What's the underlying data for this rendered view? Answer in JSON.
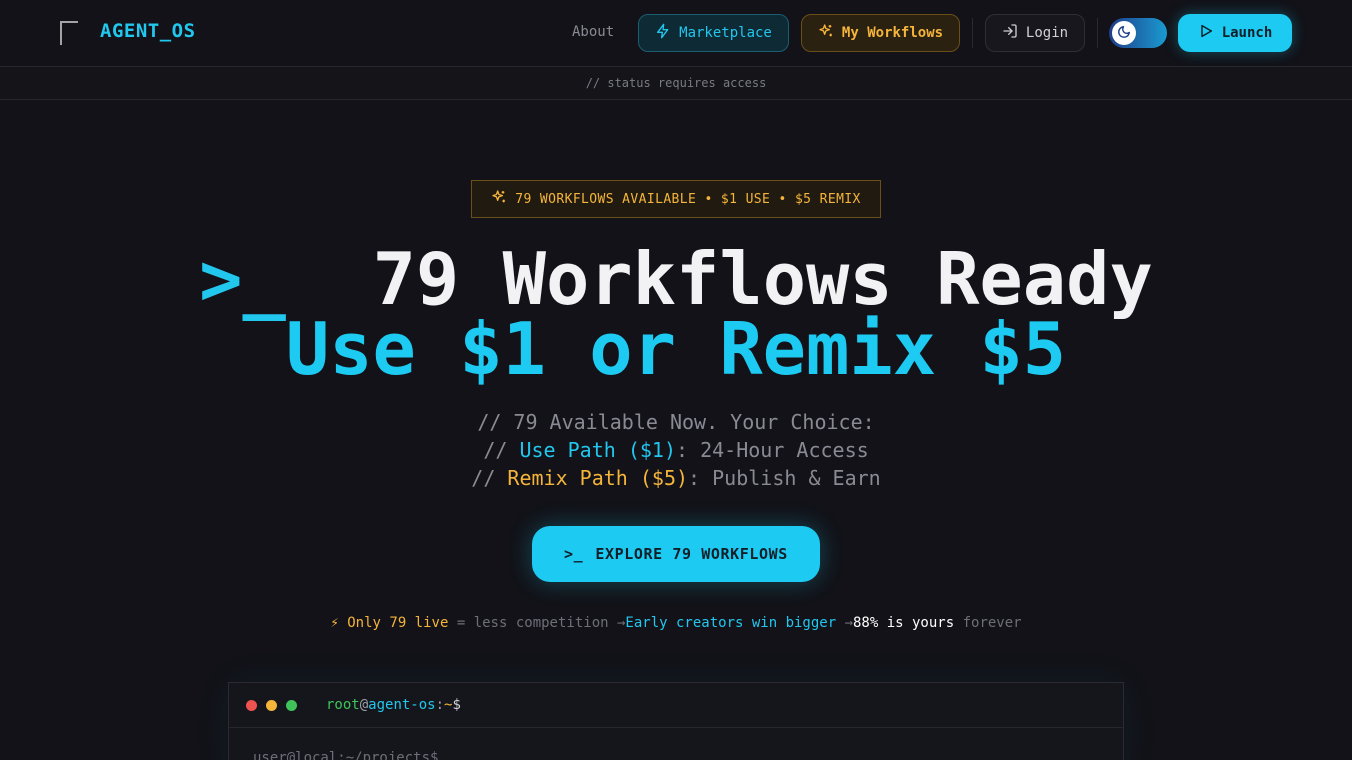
{
  "nav": {
    "logo_text": "AGENT_OS",
    "about": "About",
    "marketplace": "Marketplace",
    "my_workflows": "My Workflows",
    "login": "Login",
    "launch": "Launch"
  },
  "status_bar": {
    "text": "// status requires access"
  },
  "badge": {
    "text": "79 WORKFLOWS AVAILABLE • $1 USE • $5 REMIX"
  },
  "hero": {
    "prompt": ">_",
    "title": "79 Workflows Ready",
    "subtitle": "Use $1 or Remix $5",
    "line1": "// 79 Available Now. Your Choice:",
    "line2_prefix": "// ",
    "line2_highlight": "Use Path ($1)",
    "line2_rest": ": 24-Hour Access",
    "line3_prefix": "// ",
    "line3_highlight": "Remix Path ($5)",
    "line3_rest": ": Publish & Earn",
    "cta_icon": ">_",
    "cta_label": "EXPLORE 79 WORKFLOWS"
  },
  "tagline": {
    "part1": "⚡ Only 79 live",
    "part2": " = less competition →",
    "part3": "Early creators win bigger",
    "part4": " →",
    "part5": "88% is yours",
    "part6": " forever"
  },
  "terminal": {
    "user": "root",
    "at": "@",
    "host": "agent-os",
    "colon": ":",
    "path": "~",
    "dollar": "$",
    "body": "user@local:~/projects$"
  },
  "colors": {
    "accent_cyan": "#1dcaf2",
    "accent_orange": "#f5b53a",
    "background": "#121218"
  },
  "icons": [
    "broken-image-icon",
    "lightning-icon",
    "sparkles-icon",
    "login-icon",
    "moon-icon",
    "play-icon",
    "terminal-icon"
  ]
}
